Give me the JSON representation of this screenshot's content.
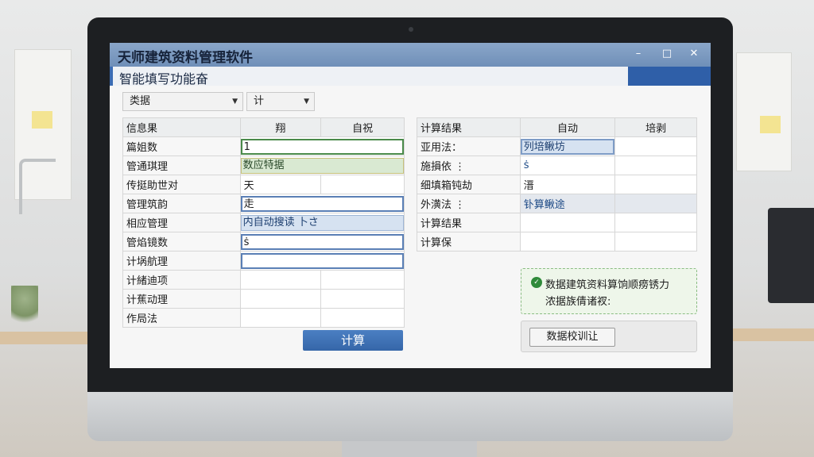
{
  "app": {
    "title": "天师建筑资料管理软件",
    "subtitle": "智能填写功能奋",
    "window_controls": {
      "minimize": "–",
      "maximize": "□",
      "close": "✕"
    }
  },
  "toolbar": {
    "select1": {
      "value": "类据",
      "options": [
        "类据"
      ]
    },
    "select2": {
      "value": "计",
      "options": [
        "计"
      ]
    }
  },
  "left_table": {
    "headers": [
      "信息果",
      "翔",
      "自祝"
    ],
    "rows": [
      {
        "label": "篇姐数",
        "value": "1",
        "style": "green"
      },
      {
        "label": "管通琪理",
        "value": "数应特据",
        "style": "green-fill"
      },
      {
        "label": "传挺助世对",
        "value": "天",
        "style": "plain"
      },
      {
        "label": "管理筑韵",
        "value": "走",
        "style": "blue"
      },
      {
        "label": "相应管理",
        "value": "内自动搜读 卜さ",
        "style": "blue-fill"
      },
      {
        "label": "管焰镜数",
        "value": "ṡ",
        "style": "blue"
      },
      {
        "label": "计埚航理",
        "value": "",
        "style": "blue"
      },
      {
        "label": "计緒迪项",
        "value": "",
        "style": "plain"
      },
      {
        "label": "计蕉动理",
        "value": "",
        "style": "plain"
      },
      {
        "label": "作局法",
        "value": "",
        "style": "plain"
      }
    ]
  },
  "right_table": {
    "headers": [
      "计算结果",
      "自动",
      "培剥"
    ],
    "rows": [
      {
        "label": "亚用法：",
        "value": "列培鳅坊",
        "style": "blue-fill"
      },
      {
        "label": "施損依 ⋮",
        "value": "ṡ",
        "style": "text-blue"
      },
      {
        "label": "细填箱钝劫",
        "value": "溍",
        "style": "plain"
      },
      {
        "label": "外潢法 ⋮",
        "value": "钋算鳅途",
        "style": "gray-fill"
      },
      {
        "label": "计算结果",
        "value": "",
        "style": "plain"
      },
      {
        "label": "计算保",
        "value": "",
        "style": "plain"
      }
    ]
  },
  "buttons": {
    "calculate": "计算",
    "verify": "数据校训让"
  },
  "notice": {
    "icon": "check-circle-icon",
    "line1": "数据建筑资料算饷顺痨锈力",
    "line2": "浓据族倩诸衩:"
  },
  "colors": {
    "title_bar": "#6f8fb8",
    "subheader_accent": "#2f5fa8",
    "primary_button": "#3566a8",
    "notice_bg": "#eef6ea",
    "green_border": "#4a8a4a",
    "blue_border": "#5a7fb5"
  }
}
